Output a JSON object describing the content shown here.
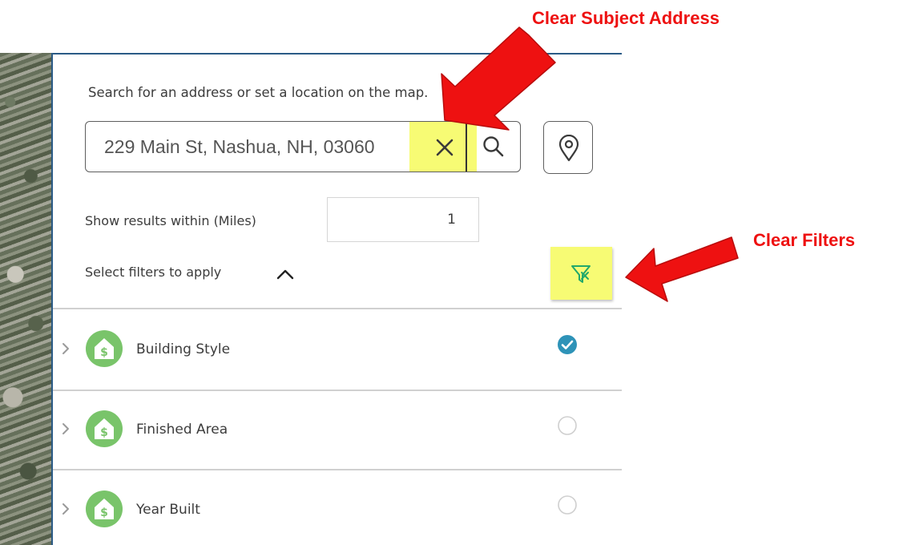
{
  "search": {
    "instruction": "Search for an address or set a location on the map.",
    "value": "229 Main St, Nashua, NH, 03060",
    "placeholder": ""
  },
  "radius": {
    "label": "Show results within (Miles)",
    "value": "1"
  },
  "filters": {
    "toggle_label": "Select filters to apply",
    "items": [
      {
        "label": "Building Style",
        "checked": true
      },
      {
        "label": "Finished Area",
        "checked": false
      },
      {
        "label": "Year Built",
        "checked": false
      }
    ]
  },
  "callouts": {
    "clear_address": "Clear Subject Address",
    "clear_filters": "Clear Filters"
  },
  "colors": {
    "highlight": "#f7fb74",
    "callout": "#ee1111",
    "filter_icon": "#79c46a",
    "check": "#2e93b8",
    "panel_border": "#2b5b86"
  },
  "icons": {
    "clear": "close-icon",
    "search": "search-icon",
    "locate": "map-pin-icon",
    "clear_filters": "filter-clear-icon",
    "collapse": "chevron-up-icon",
    "expand": "chevron-right-icon",
    "filter_item": "house-dollar-icon",
    "checked": "check-circle-icon",
    "unchecked": "empty-circle-icon"
  }
}
